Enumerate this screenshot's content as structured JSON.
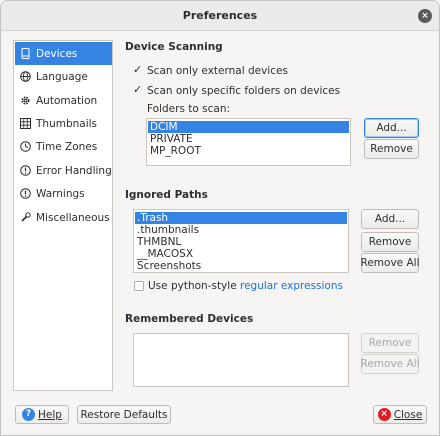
{
  "window": {
    "title": "Preferences",
    "close_glyph": "×"
  },
  "sidebar": {
    "items": [
      {
        "label": "Devices",
        "icon": "device-icon",
        "active": true
      },
      {
        "label": "Language",
        "icon": "globe-icon",
        "active": false
      },
      {
        "label": "Automation",
        "icon": "gear-icon",
        "active": false
      },
      {
        "label": "Thumbnails",
        "icon": "thumbnails-icon",
        "active": false
      },
      {
        "label": "Time Zones",
        "icon": "clock-icon",
        "active": false
      },
      {
        "label": "Error Handling",
        "icon": "error-icon",
        "active": false
      },
      {
        "label": "Warnings",
        "icon": "warning-icon",
        "active": false
      },
      {
        "label": "Miscellaneous",
        "icon": "wrench-icon",
        "active": false
      }
    ]
  },
  "device_scanning": {
    "title": "Device Scanning",
    "scan_external_label": "Scan only external devices",
    "scan_external_checked": true,
    "scan_specific_label": "Scan only specific folders on devices",
    "scan_specific_checked": true,
    "folders_label": "Folders to scan:",
    "folders": [
      "DCIM",
      "PRIVATE",
      "MP_ROOT"
    ],
    "selected_folder": "DCIM",
    "add_label": "Add...",
    "remove_label": "Remove"
  },
  "ignored_paths": {
    "title": "Ignored Paths",
    "paths": [
      ".Trash",
      ".thumbnails",
      "THMBNL",
      "__MACOSX",
      "Screenshots"
    ],
    "selected_path": ".Trash",
    "add_label": "Add...",
    "remove_label": "Remove",
    "remove_all_label": "Remove All",
    "regex_label_prefix": "Use python-style ",
    "regex_link": "regular expressions",
    "regex_checked": false
  },
  "remembered_devices": {
    "title": "Remembered Devices",
    "remove_label": "Remove",
    "remove_all_label": "Remove All"
  },
  "footer": {
    "help_label": "Help",
    "help_glyph": "?",
    "restore_label": "Restore Defaults",
    "close_label": "Close",
    "close_glyph": "×"
  },
  "colors": {
    "accent": "#3584e4",
    "link": "#1c71d8",
    "close_red": "#e01b24"
  }
}
